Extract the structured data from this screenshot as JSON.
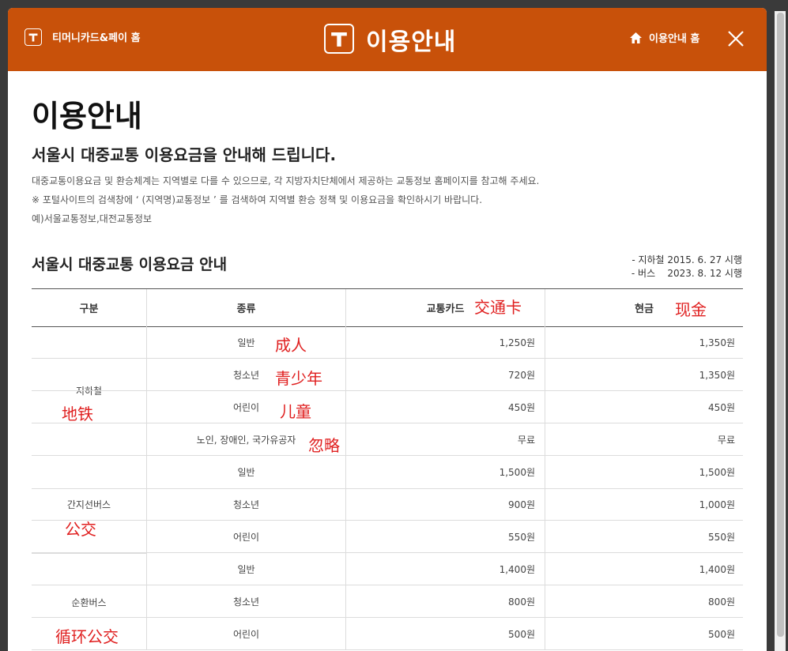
{
  "colors": {
    "brand": "#c8510a",
    "annotation": "#e02020"
  },
  "header": {
    "home_link": "티머니카드&페이 홈",
    "title": "이용안내",
    "guide_link": "이용안내 홈",
    "icons": [
      "tmoney-logo-icon",
      "home-icon",
      "close-icon"
    ]
  },
  "page": {
    "heading": "이용안내",
    "subtitle": "서울시 대중교통 이용요금을 안내해 드립니다.",
    "notes": [
      "대중교통이용요금 및 환승체계는 지역별로 다를 수 있으므로, 각 지방자치단체에서 제공하는 교통정보 홈페이지를 참고해 주세요.",
      "※ 포털사이트의 검색창에 ‘ (지역명)교통정보 ’ 를 검색하여 지역별 환승 정책 및 이용요금을 확인하시기 바랍니다.",
      "예)서울교통정보,대전교통정보"
    ]
  },
  "section": {
    "title": "서울시 대중교통 이용요금 안내",
    "effective": [
      "- 지하철 2015. 6. 27 시행",
      "- 버스    2023. 8. 12 시행"
    ]
  },
  "table": {
    "headers": [
      "구분",
      "종류",
      "교통카드",
      "현금"
    ],
    "groups": [
      {
        "name": "지하철",
        "rows": [
          {
            "kind": "일반",
            "card": "1,250원",
            "cash": "1,350원"
          },
          {
            "kind": "청소년",
            "card": "720원",
            "cash": "1,350원"
          },
          {
            "kind": "어린이",
            "card": "450원",
            "cash": "450원"
          },
          {
            "kind": "노인, 장애인, 국가유공자",
            "card": "무료",
            "cash": "무료"
          }
        ]
      },
      {
        "name": "간지선버스",
        "rows": [
          {
            "kind": "일반",
            "card": "1,500원",
            "cash": "1,500원"
          },
          {
            "kind": "청소년",
            "card": "900원",
            "cash": "1,000원"
          },
          {
            "kind": "어린이",
            "card": "550원",
            "cash": "550원"
          }
        ]
      },
      {
        "name": "순환버스",
        "rows": [
          {
            "kind": "일반",
            "card": "1,400원",
            "cash": "1,400원"
          },
          {
            "kind": "청소년",
            "card": "800원",
            "cash": "800원"
          },
          {
            "kind": "어린이",
            "card": "500원",
            "cash": "500원"
          }
        ]
      }
    ]
  },
  "annotations": {
    "card": "交通卡",
    "cash": "现金",
    "adult": "成人",
    "youth": "青少年",
    "child": "儿童",
    "ignore": "忽略",
    "subway": "地铁",
    "bus": "公交",
    "circular_bus": "循环公交"
  }
}
